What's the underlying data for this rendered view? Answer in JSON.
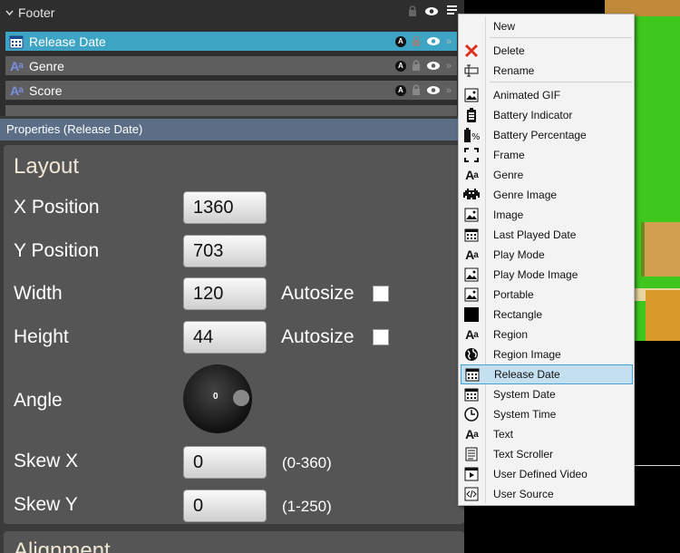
{
  "tree": {
    "header": "Footer",
    "rows": [
      {
        "label": "Release Date",
        "icon": "calendar-icon"
      },
      {
        "label": "Genre",
        "icon": "text-icon"
      },
      {
        "label": "Score",
        "icon": "text-icon"
      }
    ],
    "badge": "A"
  },
  "properties": {
    "header": "Properties (Release Date)",
    "section_title": "Layout",
    "x_label": "X Position",
    "x_value": "1360",
    "y_label": "Y Position",
    "y_value": "703",
    "width_label": "Width",
    "width_value": "120",
    "height_label": "Height",
    "height_value": "44",
    "autosize_label": "Autosize",
    "angle_label": "Angle",
    "angle_value": "0",
    "skewx_label": "Skew X",
    "skewx_value": "0",
    "skewx_range": "(0-360)",
    "skewy_label": "Skew Y",
    "skewy_value": "0",
    "skewy_range": "(1-250)",
    "next_section": "Alignment"
  },
  "menu": {
    "items": [
      {
        "label": "New",
        "icon": ""
      },
      {
        "label": "Delete",
        "icon": "delete-x-icon"
      },
      {
        "label": "Rename",
        "icon": "rename-icon"
      },
      {
        "label": "Animated GIF",
        "icon": "image-icon"
      },
      {
        "label": "Battery Indicator",
        "icon": "battery-icon"
      },
      {
        "label": "Battery Percentage",
        "icon": "battery-percent-icon"
      },
      {
        "label": "Frame",
        "icon": "frame-icon"
      },
      {
        "label": "Genre",
        "icon": "text-icon"
      },
      {
        "label": "Genre Image",
        "icon": "invader-icon"
      },
      {
        "label": "Image",
        "icon": "image-icon"
      },
      {
        "label": "Last Played Date",
        "icon": "calendar-icon"
      },
      {
        "label": "Play Mode",
        "icon": "text-icon"
      },
      {
        "label": "Play Mode Image",
        "icon": "image-icon"
      },
      {
        "label": "Portable",
        "icon": "image-icon"
      },
      {
        "label": "Rectangle",
        "icon": "rectangle-icon"
      },
      {
        "label": "Region",
        "icon": "text-icon"
      },
      {
        "label": "Region Image",
        "icon": "globe-icon"
      },
      {
        "label": "Release Date",
        "icon": "calendar-icon"
      },
      {
        "label": "System Date",
        "icon": "calendar-icon"
      },
      {
        "label": "System Time",
        "icon": "clock-icon"
      },
      {
        "label": "Text",
        "icon": "text-icon"
      },
      {
        "label": "Text Scroller",
        "icon": "scroller-icon"
      },
      {
        "label": "User Defined Video",
        "icon": "video-icon"
      },
      {
        "label": "User Source",
        "icon": "code-icon"
      }
    ],
    "highlighted": "Release Date"
  },
  "colors": {
    "selected_row": "#3da4c4",
    "menu_highlight": "#c4e0f0",
    "prop_header": "#5b6e86"
  }
}
